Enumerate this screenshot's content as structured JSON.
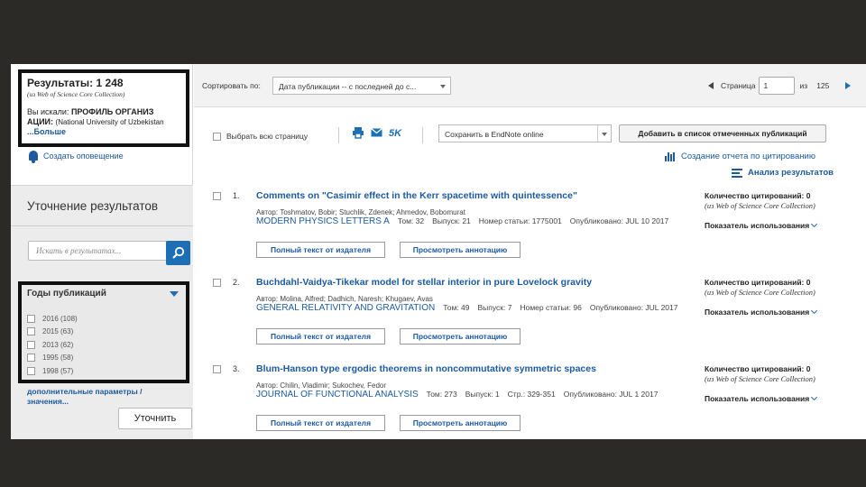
{
  "summary": {
    "results_label": "Результаты: 1 248",
    "source": "(из Web of Science Core Collection)",
    "query_prefix": "Вы искали:",
    "query_value": "ПРОФИЛЬ ОРГАНИЗ АЦИИ:",
    "query_detail": "(National University of Uzbekistan",
    "more_link": "...Больше"
  },
  "alert": {
    "label": "Создать оповещение",
    "icon": "bell-icon"
  },
  "refine": {
    "title": "Уточнение результатов",
    "search_placeholder": "Искать в результатах...",
    "years_title": "Годы публикаций",
    "years": [
      {
        "label": "2016 (108)"
      },
      {
        "label": "2015 (63)"
      },
      {
        "label": "2013 (62)"
      },
      {
        "label": "1995 (58)"
      },
      {
        "label": "1998 (57)"
      }
    ],
    "more_params": "дополнительные параметры / значения...",
    "refine_button": "Уточнить"
  },
  "topbar": {
    "sort_label": "Сортировать по:",
    "sort_value": "Дата публикации -- с последней до с...",
    "page_label": "Страница",
    "page_value": "1",
    "of_label": "из",
    "total_pages": "125"
  },
  "toolbar": {
    "select_page": "Выбрать всю страницу",
    "fivek": "5K",
    "save_option": "Сохранить в EndNote online",
    "add_marked": "Добавить в список отмеченных публикаций"
  },
  "links": {
    "citation_report": "Создание отчета по цитированию",
    "analysis": "Анализ результатов"
  },
  "records": [
    {
      "num": "1.",
      "title": "Comments on \"Casimir effect in the Kerr spacetime with quintessence\"",
      "authors": "Автор: Toshmatov, Bobir; Stuchlik, Zdenek; Ahmedov, Bobomurat",
      "journal": "MODERN PHYSICS LETTERS A",
      "volume": "Том: 32",
      "issue": "Выпуск: 21",
      "extra": "Номер статьи: 1775001",
      "published": "Опубликовано: JUL 10 2017",
      "full_text": "Полный текст от издателя",
      "abstract": "Просмотреть аннотацию",
      "citations": "Количество цитирований: 0",
      "citations_src": "(из Web of Science Core Collection)",
      "usage": "Показатель использования"
    },
    {
      "num": "2.",
      "title": "Buchdahl-Vaidya-Tikekar model for stellar interior in pure Lovelock gravity",
      "authors": "Автор: Molina, Alfred; Dadhich, Naresh; Khugaev, Avas",
      "journal": "GENERAL RELATIVITY AND GRAVITATION",
      "volume": "Том: 49",
      "issue": "Выпуск: 7",
      "extra": "Номер статьи: 96",
      "published": "Опубликовано: JUL 2017",
      "full_text": "Полный текст от издателя",
      "abstract": "Просмотреть аннотацию",
      "citations": "Количество цитирований: 0",
      "citations_src": "(из Web of Science Core Collection)",
      "usage": "Показатель использования"
    },
    {
      "num": "3.",
      "title": "Blum-Hanson type ergodic theorems in noncommutative symmetric spaces",
      "authors": "Автор: Chilin, Vladimir; Sukochev, Fedor",
      "journal": "JOURNAL OF FUNCTIONAL ANALYSIS",
      "volume": "Том: 273",
      "issue": "Выпуск: 1",
      "extra": "Стр.: 329-351",
      "published": "Опубликовано: JUL 1 2017",
      "full_text": "Полный текст от издателя",
      "abstract": "Просмотреть аннотацию",
      "citations": "Количество цитирований: 0",
      "citations_src": "(из Web of Science Core Collection)",
      "usage": "Показатель использования"
    }
  ]
}
